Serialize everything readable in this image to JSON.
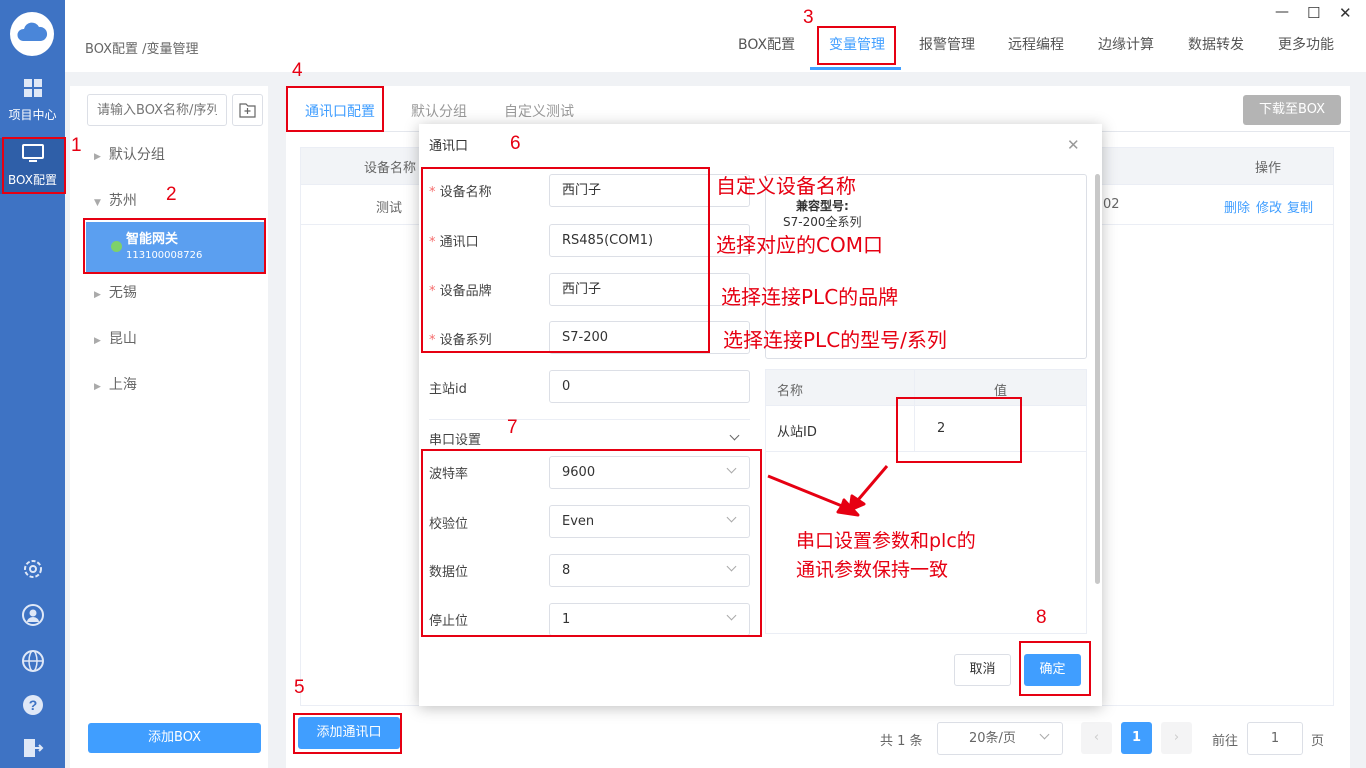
{
  "window": {
    "minimize": "—",
    "maximize": "☐",
    "close": "✕"
  },
  "rail": {
    "items": [
      {
        "label": "项目中心",
        "icon": "grid-icon"
      },
      {
        "label": "BOX配置",
        "icon": "monitor-icon"
      }
    ],
    "bottom_icons": [
      "settings-icon",
      "user-icon",
      "globe-icon",
      "help-icon",
      "logout-icon"
    ]
  },
  "header": {
    "breadcrumb": "BOX配置 /变量管理",
    "tabs": [
      "BOX配置",
      "变量管理",
      "报警管理",
      "远程编程",
      "边缘计算",
      "数据转发",
      "更多功能"
    ],
    "active_tab": "变量管理"
  },
  "sidebar": {
    "search_placeholder": "请输入BOX名称/序列",
    "groups": {
      "default": "默认分组",
      "suzhou": "苏州",
      "wuxi": "无锡",
      "kunshan": "昆山",
      "shanghai": "上海"
    },
    "device": {
      "name": "智能网关",
      "serial": "113100008726"
    },
    "add_box": "添加BOX"
  },
  "main": {
    "subtabs": [
      "通讯口配置",
      "默认分组",
      "自定义测试"
    ],
    "download_button": "下载至BOX",
    "table": {
      "headers": {
        "device_name": "设备名称",
        "ops": "操作"
      },
      "row": {
        "name": "测试",
        "partial": "02",
        "ops": [
          "删除",
          "修改",
          "复制"
        ]
      }
    },
    "add_port": "添加通讯口",
    "pagination": {
      "total": "共 1 条",
      "page_size": "20条/页",
      "page": "1",
      "goto_label": "前往",
      "goto_value": "1",
      "goto_suffix": "页"
    }
  },
  "modal": {
    "title": "通讯口",
    "fields": [
      {
        "label": "设备名称",
        "value": "西门子",
        "required": true
      },
      {
        "label": "通讯口",
        "value": "RS485(COM1)",
        "required": true
      },
      {
        "label": "设备品牌",
        "value": "西门子",
        "required": true
      },
      {
        "label": "设备系列",
        "value": "S7-200",
        "required": true
      },
      {
        "label": "主站id",
        "value": "0",
        "required": false
      }
    ],
    "serial_section": "串口设置",
    "serial": [
      {
        "label": "波特率",
        "value": "9600"
      },
      {
        "label": "校验位",
        "value": "Even"
      },
      {
        "label": "数据位",
        "value": "8"
      },
      {
        "label": "停止位",
        "value": "1"
      }
    ],
    "compat_title": "兼容型号:",
    "compat_value": "S7-200全系列",
    "param_table": {
      "headers": [
        "名称",
        "值"
      ],
      "row": {
        "name": "从站ID",
        "value": "2"
      }
    },
    "cancel": "取消",
    "confirm": "确定"
  },
  "annotations": {
    "numbers": [
      "1",
      "2",
      "3",
      "4",
      "5",
      "6",
      "7",
      "8"
    ],
    "notes": {
      "name": "自定义设备名称",
      "com": "选择对应的COM口",
      "brand": "选择连接PLC的品牌",
      "series": "选择连接PLC的型号/系列",
      "serial_1": "串口设置参数和plc的",
      "serial_2": "通讯参数保持一致"
    },
    "color": "#e60012"
  }
}
